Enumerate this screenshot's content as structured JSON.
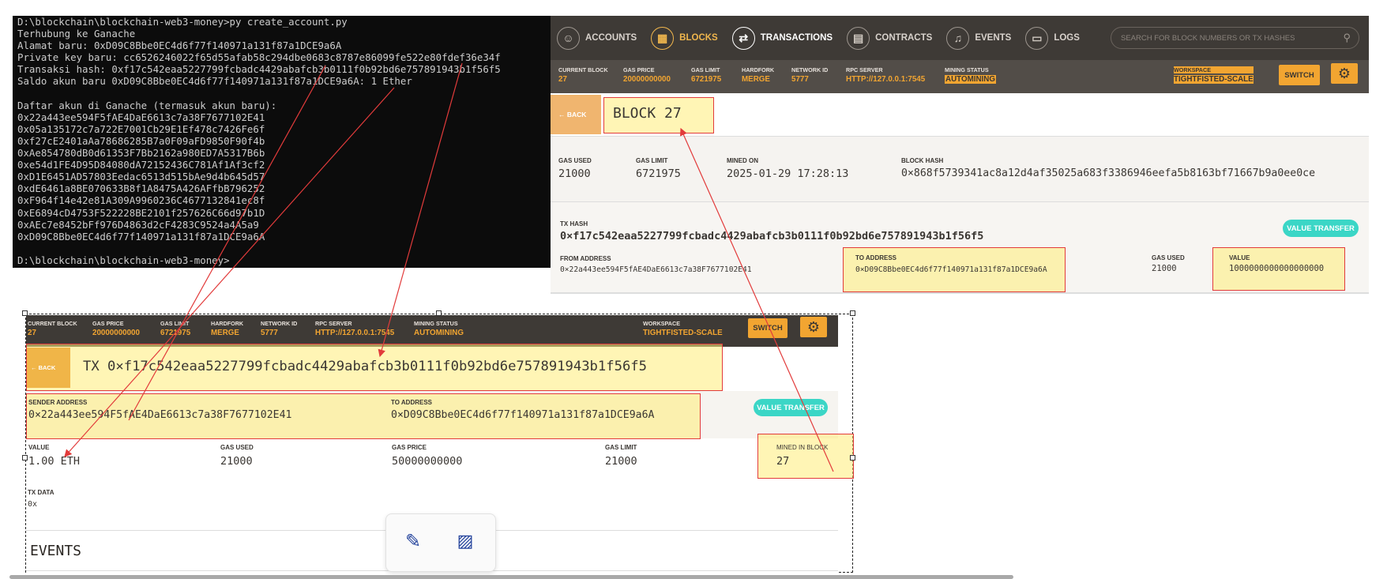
{
  "terminal": {
    "lines": [
      "D:\\blockchain\\blockchain-web3-money>py create_account.py",
      "Terhubung ke Ganache",
      "Alamat baru: 0xD09C8Bbe0EC4d6f77f140971a131f87a1DCE9a6A",
      "Private key baru: cc6526246022f65d55afab58c294dbe0683c8787e86099fe522e80fdef36e34f",
      "Transaksi hash: 0xf17c542eaa5227799fcbadc4429abafcb3b0111f0b92bd6e757891943b1f56f5",
      "Saldo akun baru 0xD09C8Bbe0EC4d6f77f140971a131f87a1DCE9a6A: 1 Ether",
      "",
      "Daftar akun di Ganache (termasuk akun baru):",
      "0x22a443ee594F5fAE4DaE6613c7a38F7677102E41",
      "0x05a135172c7a722E7001Cb29E1Ef478c7426Fe6f",
      "0xf27cE2401aAa78686285B7a0F09aFD9850F90f4b",
      "0xAe854780dB0d61353F7Bb2162a980ED7A5317B6b",
      "0xe54d1FE4D95D84080dA72152436C781Af1Af3cf2",
      "0xD1E6451AD57803Eedac6513d515bAe9d4b645d57",
      "0xdE6461a8BE070633B8f1A8475A426AFfbB796252",
      "0xF964f14e42e81A309A9960236C4677132841ec8f",
      "0xE6894cD4753F522228BE2101f257626C66d97b1D",
      "0xAEc7e8452bFf976D4863d2cF4283C9524a4A5a9",
      "0xD09C8Bbe0EC4d6f77f140971a131f87a1DCE9a6A",
      "",
      "D:\\blockchain\\blockchain-web3-money>"
    ]
  },
  "nav": {
    "accounts": "ACCOUNTS",
    "blocks": "BLOCKS",
    "transactions": "TRANSACTIONS",
    "contracts": "CONTRACTS",
    "events": "EVENTS",
    "logs": "LOGS",
    "search_placeholder": "SEARCH FOR BLOCK NUMBERS OR TX HASHES"
  },
  "status": {
    "current_block_label": "CURRENT BLOCK",
    "current_block": "27",
    "gas_price_label": "GAS PRICE",
    "gas_price": "20000000000",
    "gas_limit_label": "GAS LIMIT",
    "gas_limit": "6721975",
    "hardfork_label": "HARDFORK",
    "hardfork": "MERGE",
    "network_id_label": "NETWORK ID",
    "network_id": "5777",
    "rpc_server_label": "RPC SERVER",
    "rpc_server": "HTTP://127.0.0.1:7545",
    "mining_status_label": "MINING STATUS",
    "mining_status": "AUTOMINING",
    "workspace_label": "WORKSPACE",
    "workspace": "TIGHTFISTED-SCALE",
    "switch": "SWITCH"
  },
  "block_page": {
    "back": "← BACK",
    "title": "BLOCK 27",
    "gas_used_label": "GAS USED",
    "gas_used": "21000",
    "gas_limit_label": "GAS LIMIT",
    "gas_limit": "6721975",
    "mined_on_label": "MINED ON",
    "mined_on": "2025-01-29 17:28:13",
    "block_hash_label": "BLOCK HASH",
    "block_hash": "0×868f5739341ac8a12d4af35025a683f3386946eefa5b8163bf71667b9a0ee0ce",
    "tx_hash_label": "TX HASH",
    "tx_hash": "0×f17c542eaa5227799fcbadc4429abafcb3b0111f0b92bd6e757891943b1f56f5",
    "value_transfer": "VALUE TRANSFER",
    "from_label": "FROM ADDRESS",
    "from": "0×22a443ee594F5fAE4DaE6613c7a38F7677102E41",
    "to_label": "TO ADDRESS",
    "to": "0×D09C8Bbe0EC4d6f77f140971a131f87a1DCE9a6A",
    "tx_gas_used_label": "GAS USED",
    "tx_gas_used": "21000",
    "value_label": "VALUE",
    "value": "1000000000000000000"
  },
  "tx_page": {
    "back": "← BACK",
    "title": "TX 0×f17c542eaa5227799fcbadc4429abafcb3b0111f0b92bd6e757891943b1f56f5",
    "sender_label": "SENDER ADDRESS",
    "sender": "0×22a443ee594F5fAE4DaE6613c7a38F7677102E41",
    "to_label": "TO ADDRESS",
    "to": "0×D09C8Bbe0EC4d6f77f140971a131f87a1DCE9a6A",
    "value_transfer": "VALUE TRANSFER",
    "value_label": "VALUE",
    "value": "1.00 ETH",
    "gas_used_label": "GAS USED",
    "gas_used": "21000",
    "gas_price_label": "GAS PRICE",
    "gas_price": "50000000000",
    "gas_limit_label": "GAS LIMIT",
    "gas_limit": "21000",
    "mined_label": "MINED IN BLOCK",
    "mined": "27",
    "tx_data_label": "TX DATA",
    "tx_data": "0x",
    "events": "EVENTS"
  },
  "colors": {
    "accent": "#f2a531",
    "nav_bg": "#3e3a36",
    "teal": "#3bd6c6",
    "arrow": "#e23b3b"
  }
}
